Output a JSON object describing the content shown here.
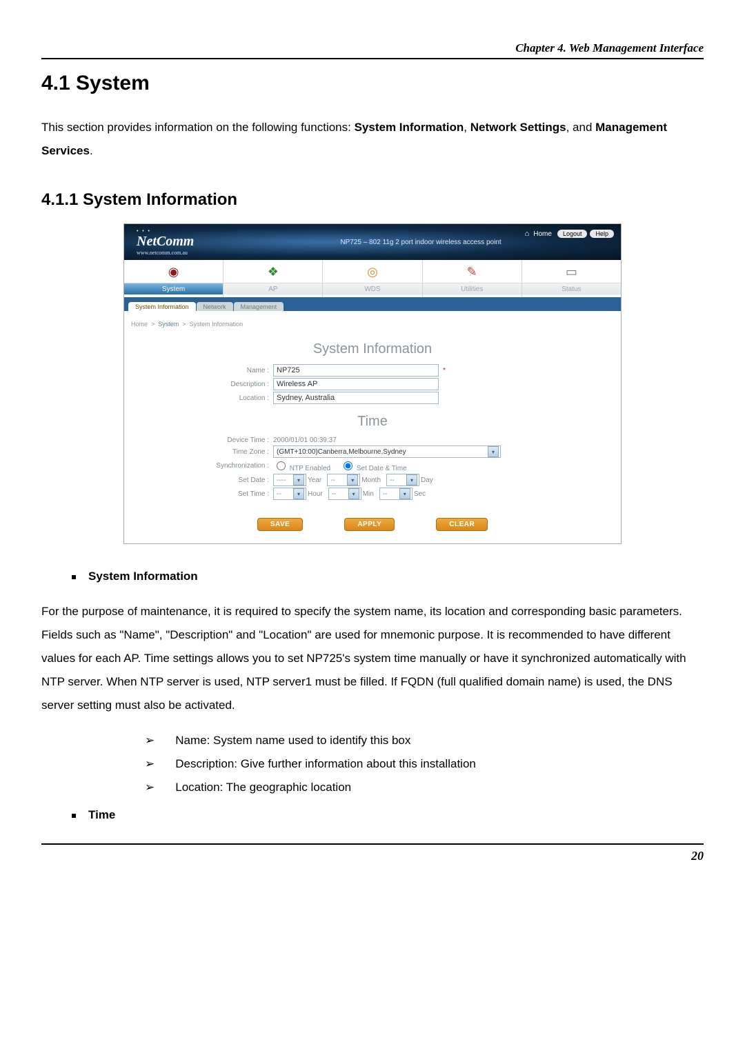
{
  "header": {
    "text": "Chapter 4. Web Management Interface"
  },
  "section": {
    "num_title": "4.1   System",
    "intro_1": "This section provides information on the following functions: ",
    "intro_b1": "System Information",
    "intro_sep1": ", ",
    "intro_b2": "Network Settings",
    "intro_sep2": ", and ",
    "intro_b3": "Management Services",
    "intro_end": "."
  },
  "subsection": {
    "num_title": "4.1.1  System Information"
  },
  "shot": {
    "logo_text": "NetComm",
    "logo_sub": "www.netcomm.com.au",
    "banner_mid": "NP725 – 802 11g 2 port indoor wireless access point",
    "home_label": "Home",
    "pill_logout": "Logout",
    "pill_help": "Help",
    "maintabs": [
      "System",
      "AP",
      "WDS",
      "Utilities",
      "Status"
    ],
    "maintabs_active": 0,
    "subtabs": [
      "System Information",
      "Network",
      "Management"
    ],
    "subtabs_active": 0,
    "breadcrumb_home": "Home",
    "breadcrumb_sys": "System",
    "breadcrumb_tail": "System Information",
    "panel1_title": "System Information",
    "fields": {
      "name_label": "Name :",
      "name_value": "NP725",
      "desc_label": "Description :",
      "desc_value": "Wireless AP",
      "loc_label": "Location :",
      "loc_value": "Sydney, Australia"
    },
    "panel2_title": "Time",
    "time": {
      "device_time_label": "Device Time :",
      "device_time_value": "2000/01/01 00:39:37",
      "tz_label": "Time Zone :",
      "tz_value": "(GMT+10:00)Canberra,Melbourne,Sydney",
      "sync_label": "Synchronization :",
      "sync_ntp": "NTP Enabled",
      "sync_set": "Set Date & Time",
      "setdate_label": "Set Date :",
      "year_ph": "----",
      "year_unit": "Year",
      "month_ph": "--",
      "month_unit": "Month",
      "day_ph": "--",
      "day_unit": "Day",
      "settime_label": "Set Time :",
      "hour_ph": "--",
      "hour_unit": "Hour",
      "min_ph": "--",
      "min_unit": "Min",
      "sec_ph": "--",
      "sec_unit": "Sec"
    },
    "btn_save": "SAVE",
    "btn_apply": "APPLY",
    "btn_clear": "CLEAR"
  },
  "desc": {
    "bullet1_title": "System Information",
    "bullet1_body": "For the purpose of maintenance, it is required to specify the system name, its location and corresponding basic parameters. Fields such as \"Name\", \"Description\" and \"Location\" are used for mnemonic purpose. It is recommended to have different values for each AP. Time settings allows you to set NP725's system time manually or have it synchronized automatically with NTP server. When NTP server is used, NTP server1 must be filled. If FQDN (full qualified domain name) is used, the DNS server setting must also be activated.",
    "sub_items": [
      "Name: System name used to identify this box",
      "Description: Give further information about this installation",
      "Location: The geographic location"
    ],
    "bullet2_title": "Time"
  },
  "footer": {
    "page": "20"
  }
}
